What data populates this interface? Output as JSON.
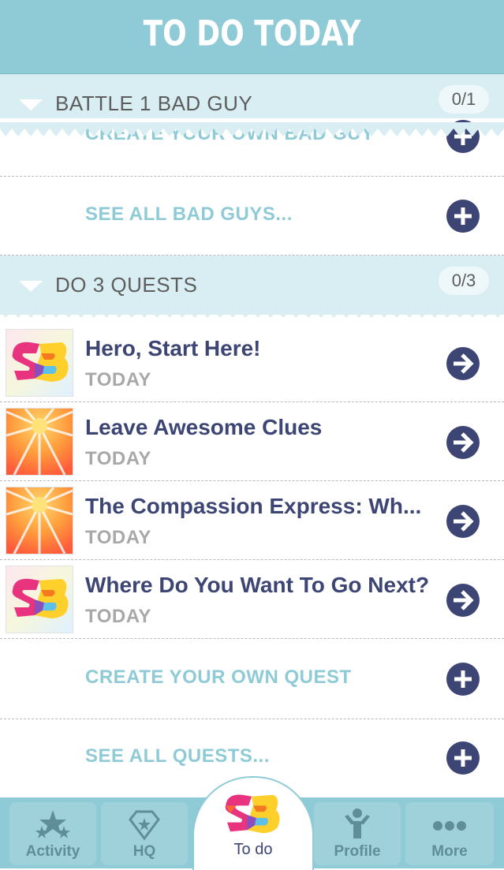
{
  "header": {
    "title": "TO DO TODAY"
  },
  "sections": [
    {
      "title": "BATTLE 1 BAD GUY",
      "count": "0/1",
      "links": [
        {
          "label": "CREATE YOUR OWN BAD GUY"
        },
        {
          "label": "SEE ALL BAD GUYS..."
        }
      ]
    },
    {
      "title": "DO 3 QUESTS",
      "count": "0/3",
      "quests": [
        {
          "title": "Hero, Start Here!",
          "due": "TODAY",
          "thumb": "sb-logo"
        },
        {
          "title": "Leave Awesome Clues",
          "due": "TODAY",
          "thumb": "sunburst"
        },
        {
          "title": "The Compassion Express: Wh...",
          "due": "TODAY",
          "thumb": "sunburst"
        },
        {
          "title": "Where Do You Want To Go Next?",
          "due": "TODAY",
          "thumb": "sb-logo"
        }
      ],
      "links": [
        {
          "label": "CREATE YOUR OWN QUEST"
        },
        {
          "label": "SEE ALL QUESTS..."
        }
      ]
    }
  ],
  "tabbar": {
    "tabs": [
      {
        "label": "Activity",
        "icon": "stars-icon"
      },
      {
        "label": "HQ",
        "icon": "emblem-icon"
      },
      {
        "label": "To do",
        "icon": "sb-logo-icon",
        "active": true
      },
      {
        "label": "Profile",
        "icon": "person-icon"
      },
      {
        "label": "More",
        "icon": "dots-icon"
      }
    ]
  },
  "colors": {
    "header": "#8ecbd6",
    "section_bg": "#d9eef2",
    "accent_link": "#8ecbd6",
    "quest_title": "#3c4574",
    "button": "#3c4574"
  }
}
